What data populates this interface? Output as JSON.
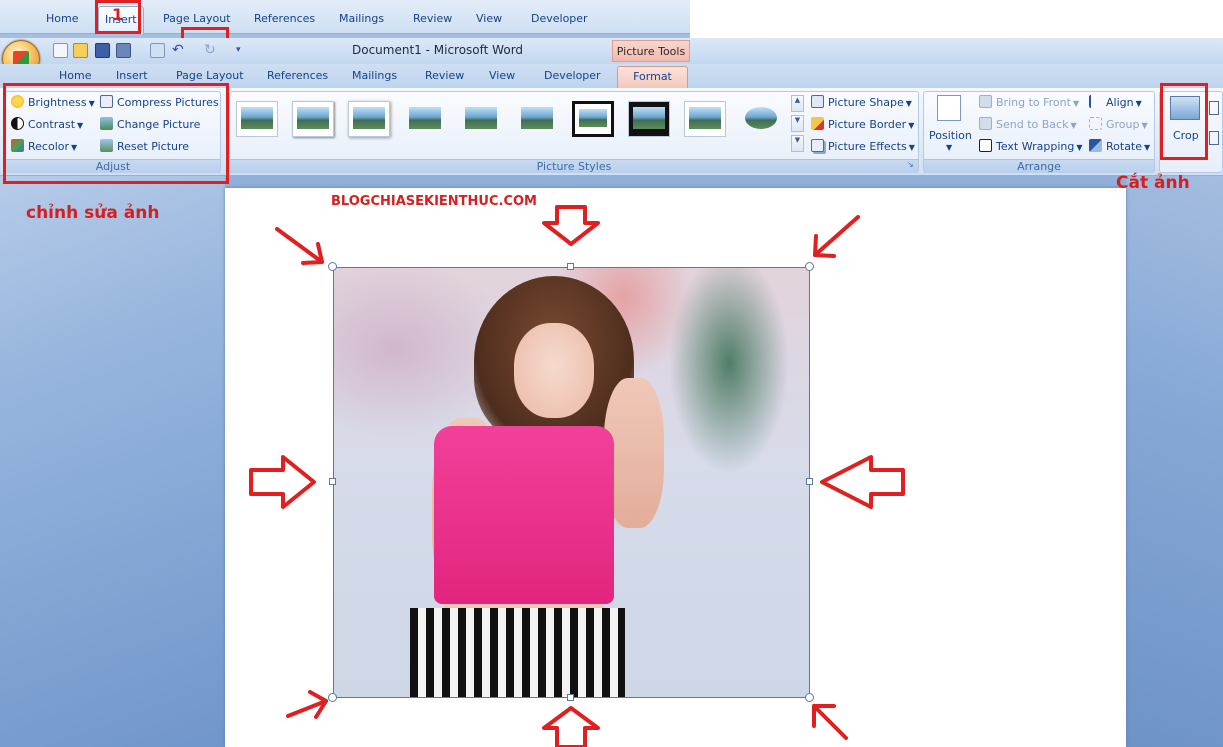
{
  "overlay_ribbon": {
    "tabs": [
      "Home",
      "Insert",
      "Page Layout",
      "References",
      "Mailings",
      "Review",
      "View",
      "Developer"
    ],
    "step_number": "1"
  },
  "title_bar": {
    "document_title": "Document1 - Microsoft Word",
    "context_label": "Picture Tools"
  },
  "tabs": {
    "home": "Home",
    "insert": "Insert",
    "page_layout": "Page Layout",
    "references": "References",
    "mailings": "Mailings",
    "review": "Review",
    "view": "View",
    "developer": "Developer",
    "format": "Format",
    "active": "Format"
  },
  "ribbon": {
    "adjust": {
      "label": "Adjust",
      "brightness": "Brightness",
      "contrast": "Contrast",
      "recolor": "Recolor",
      "compress_pictures": "Compress Pictures",
      "change_picture": "Change Picture",
      "reset_picture": "Reset Picture"
    },
    "picture_styles": {
      "label": "Picture Styles",
      "picture_shape": "Picture Shape",
      "picture_border": "Picture Border",
      "picture_effects": "Picture Effects"
    },
    "arrange": {
      "label": "Arrange",
      "position": "Position",
      "bring_to_front": "Bring to Front",
      "send_to_back": "Send to Back",
      "text_wrapping": "Text Wrapping",
      "align": "Align",
      "group": "Group",
      "rotate": "Rotate"
    },
    "size": {
      "crop": "Crop"
    }
  },
  "annotations": {
    "adjust_caption": "chỉnh sửa ảnh",
    "crop_caption": "Cắt ảnh",
    "watermark": "BLOGCHIASEKIENTHUC.COM"
  },
  "colors": {
    "annotation_red": "#e02020",
    "ribbon_text": "#15428b",
    "context_tab": "#f4c8bb"
  }
}
